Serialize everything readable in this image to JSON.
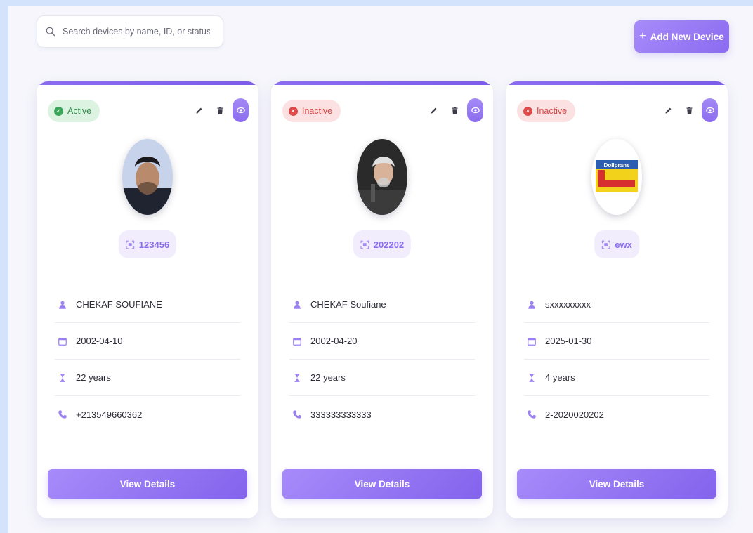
{
  "search": {
    "placeholder": "Search devices by name, ID, or status..."
  },
  "toolbar": {
    "add_plus": "+",
    "add_label": "Add New Device"
  },
  "theme": {
    "accent": "#8b6cf0",
    "active": "#39a65a",
    "inactive": "#e04848"
  },
  "cards": [
    {
      "status": "Active",
      "status_kind": "active",
      "device_id": "123456",
      "avatar": "young-man-photo",
      "name": "CHEKAF SOUFIANE",
      "date": "2002-04-10",
      "age": "22 years",
      "phone": "+213549660362",
      "button": "View Details"
    },
    {
      "status": "Inactive",
      "status_kind": "inactive",
      "device_id": "202202",
      "avatar": "older-man-speaker-photo",
      "name": "CHEKAF Soufiane",
      "date": "2002-04-20",
      "age": "22 years",
      "phone": "333333333333",
      "button": "View Details"
    },
    {
      "status": "Inactive",
      "status_kind": "inactive",
      "device_id": "ewx",
      "avatar": "doliprane-box-photo",
      "name": "sxxxxxxxxx",
      "date": "2025-01-30",
      "age": "4 years",
      "phone": "2-2020020202",
      "button": "View Details"
    }
  ],
  "icons": {
    "search": "search-icon",
    "edit": "pencil-icon",
    "delete": "trash-icon",
    "view": "eye-icon",
    "id": "scan-icon",
    "name": "user-icon",
    "date": "calendar-icon",
    "age": "hourglass-icon",
    "phone": "phone-icon"
  }
}
